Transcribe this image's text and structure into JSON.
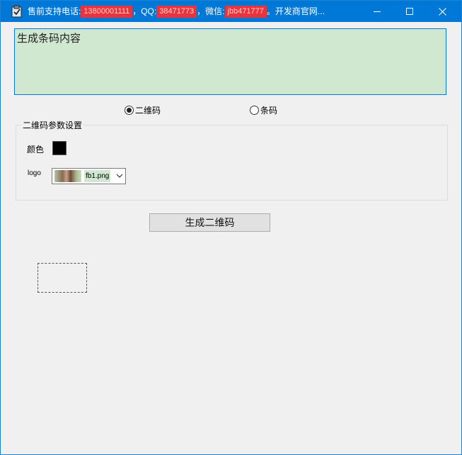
{
  "titlebar": {
    "prefix_phone": "售前支持电话:",
    "phone": "13800001111",
    "sep_qq": "，QQ:",
    "qq": "38471773",
    "sep_wechat": "，微信:",
    "wechat": "jbb471777",
    "suffix": "。开发商官网..."
  },
  "content_input": {
    "value": "生成条码内容"
  },
  "mode": {
    "qr_label": "二维码",
    "barcode_label": "条码",
    "selected": "qr"
  },
  "qr_settings": {
    "legend": "二维码参数设置",
    "color_label": "颜色",
    "color_value": "#000000",
    "logo_label": "logo",
    "logo_file": "fb1.png"
  },
  "actions": {
    "generate_label": "生成二维码"
  },
  "colors": {
    "titlebar": "#0078d7",
    "input_bg": "#cfe8cf",
    "window_bg": "#f0f0f0"
  }
}
